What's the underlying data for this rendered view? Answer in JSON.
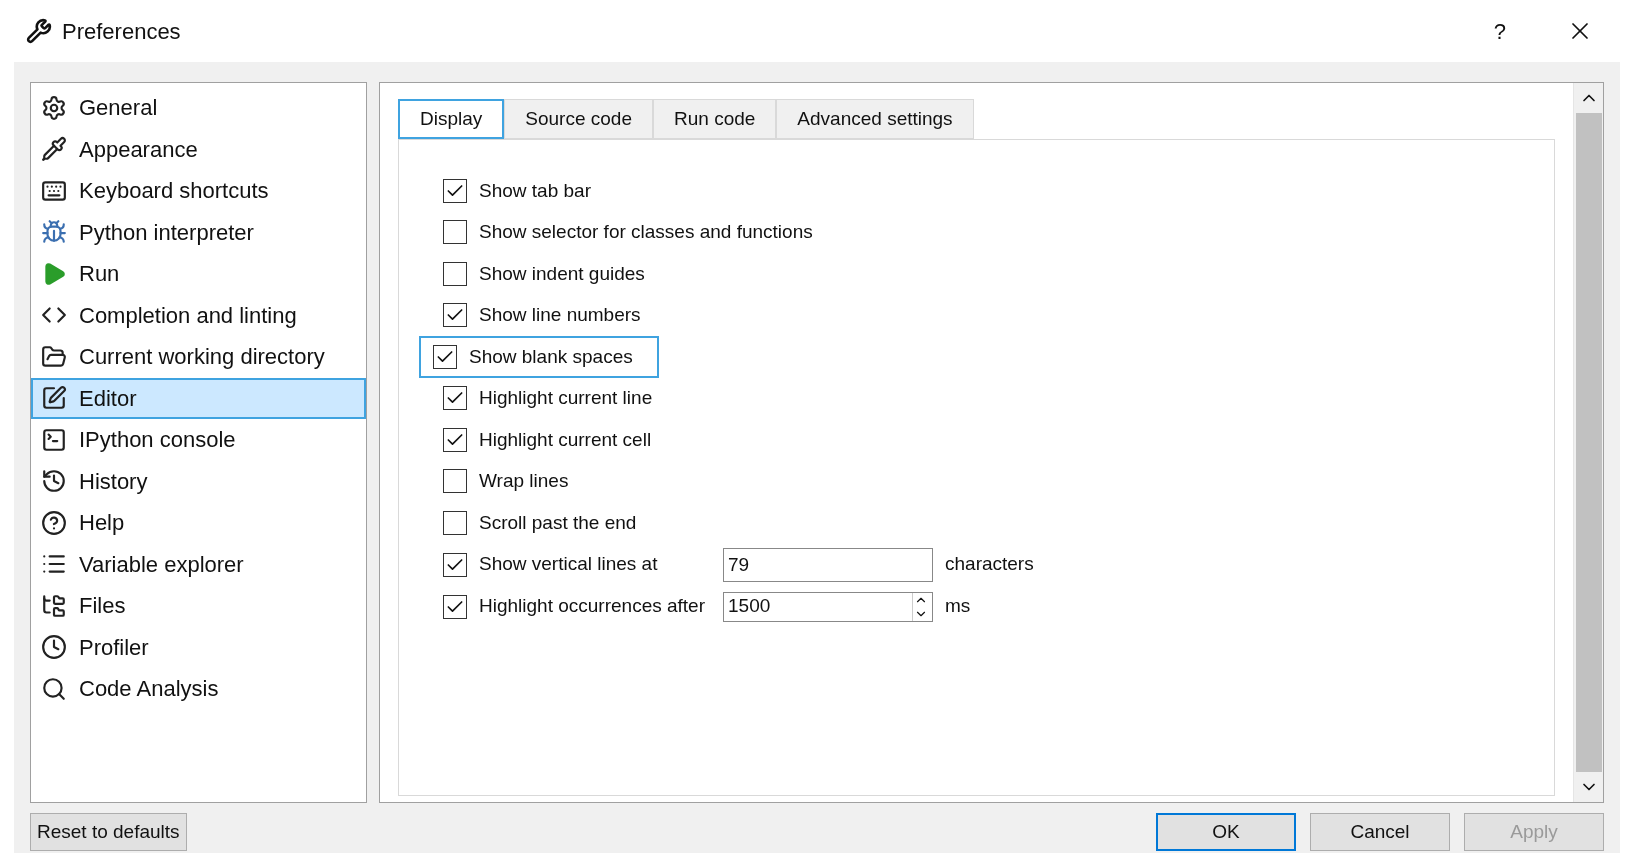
{
  "window": {
    "title": "Preferences",
    "help": "?"
  },
  "sidebar": {
    "items": [
      {
        "label": "General",
        "selected": false
      },
      {
        "label": "Appearance",
        "selected": false
      },
      {
        "label": "Keyboard shortcuts",
        "selected": false
      },
      {
        "label": "Python interpreter",
        "selected": false
      },
      {
        "label": "Run",
        "selected": false
      },
      {
        "label": "Completion and linting",
        "selected": false
      },
      {
        "label": "Current working directory",
        "selected": false
      },
      {
        "label": "Editor",
        "selected": true
      },
      {
        "label": "IPython console",
        "selected": false
      },
      {
        "label": "History",
        "selected": false
      },
      {
        "label": "Help",
        "selected": false
      },
      {
        "label": "Variable explorer",
        "selected": false
      },
      {
        "label": "Files",
        "selected": false
      },
      {
        "label": "Profiler",
        "selected": false
      },
      {
        "label": "Code Analysis",
        "selected": false
      }
    ]
  },
  "tabs": [
    {
      "label": "Display",
      "selected": true
    },
    {
      "label": "Source code",
      "selected": false
    },
    {
      "label": "Run code",
      "selected": false
    },
    {
      "label": "Advanced settings",
      "selected": false
    }
  ],
  "options": [
    {
      "kind": "check",
      "label": "Show tab bar",
      "checked": true,
      "focused": false
    },
    {
      "kind": "check",
      "label": "Show selector for classes and functions",
      "checked": false,
      "focused": false
    },
    {
      "kind": "check",
      "label": "Show indent guides",
      "checked": false,
      "focused": false
    },
    {
      "kind": "check",
      "label": "Show line numbers",
      "checked": true,
      "focused": false
    },
    {
      "kind": "check",
      "label": "Show blank spaces",
      "checked": true,
      "focused": true
    },
    {
      "kind": "check",
      "label": "Highlight current line",
      "checked": true,
      "focused": false
    },
    {
      "kind": "check",
      "label": "Highlight current cell",
      "checked": true,
      "focused": false
    },
    {
      "kind": "check",
      "label": "Wrap lines",
      "checked": false,
      "focused": false
    },
    {
      "kind": "check",
      "label": "Scroll past the end",
      "checked": false,
      "focused": false
    },
    {
      "kind": "field",
      "label": "Show vertical lines at",
      "checked": true,
      "focused": false,
      "value": "79",
      "unit": "characters"
    },
    {
      "kind": "spin",
      "label": "Highlight occurrences after",
      "checked": true,
      "focused": false,
      "value": "1500",
      "unit": "ms"
    }
  ],
  "footer": {
    "reset": "Reset to defaults",
    "buttons": [
      {
        "label": "OK",
        "default": true,
        "disabled": false
      },
      {
        "label": "Cancel",
        "default": false,
        "disabled": false
      },
      {
        "label": "Apply",
        "default": false,
        "disabled": true
      }
    ]
  }
}
